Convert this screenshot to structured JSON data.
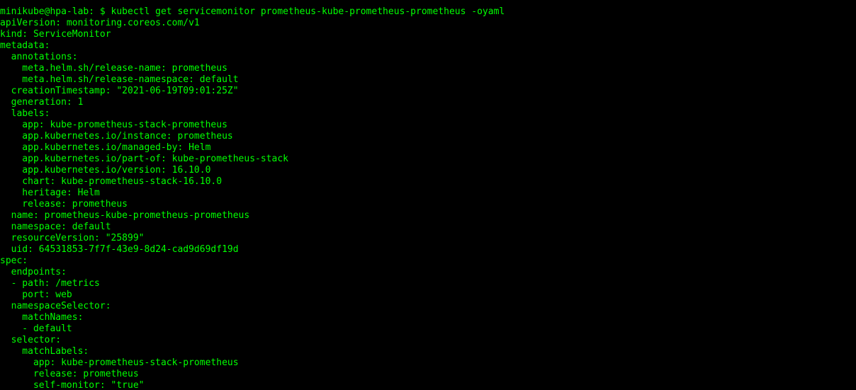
{
  "terminal": {
    "colors": {
      "background": "#000000",
      "text": "#00ff00"
    },
    "partial_top_line": "                                                             ",
    "prompt": "minikube@hpa-lab: $ kubectl get servicemonitor prometheus-kube-prometheus-prometheus -oyaml",
    "lines": [
      "apiVersion: monitoring.coreos.com/v1",
      "kind: ServiceMonitor",
      "metadata:",
      "  annotations:",
      "    meta.helm.sh/release-name: prometheus",
      "    meta.helm.sh/release-namespace: default",
      "  creationTimestamp: \"2021-06-19T09:01:25Z\"",
      "  generation: 1",
      "  labels:",
      "    app: kube-prometheus-stack-prometheus",
      "    app.kubernetes.io/instance: prometheus",
      "    app.kubernetes.io/managed-by: Helm",
      "    app.kubernetes.io/part-of: kube-prometheus-stack",
      "    app.kubernetes.io/version: 16.10.0",
      "    chart: kube-prometheus-stack-16.10.0",
      "    heritage: Helm",
      "    release: prometheus",
      "  name: prometheus-kube-prometheus-prometheus",
      "  namespace: default",
      "  resourceVersion: \"25899\"",
      "  uid: 64531853-7f7f-43e9-8d24-cad9d69df19d",
      "spec:",
      "  endpoints:",
      "  - path: /metrics",
      "    port: web",
      "  namespaceSelector:",
      "    matchNames:",
      "    - default",
      "  selector:",
      "    matchLabels:",
      "      app: kube-prometheus-stack-prometheus",
      "      release: prometheus",
      "      self-monitor: \"true\""
    ]
  }
}
